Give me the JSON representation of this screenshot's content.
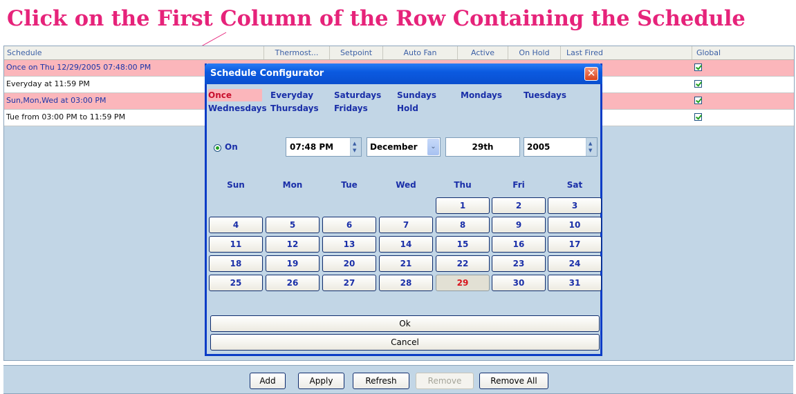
{
  "banner": {
    "text": "Click on the First Column of the Row Containing the Schedule"
  },
  "table": {
    "columns": [
      {
        "label": "Schedule"
      },
      {
        "label": "Thermost..."
      },
      {
        "label": "Setpoint"
      },
      {
        "label": "Auto Fan"
      },
      {
        "label": "Active"
      },
      {
        "label": "On Hold"
      },
      {
        "label": "Last Fired"
      },
      {
        "label": "Global"
      }
    ],
    "rows": [
      {
        "schedule": "Once on Thu 12/29/2005 07:48:00 PM",
        "global": true
      },
      {
        "schedule": "Everyday at 11:59 PM",
        "global": true
      },
      {
        "schedule": "Sun,Mon,Wed at 03:00 PM",
        "global": true
      },
      {
        "schedule": "Tue from 03:00 PM to 11:59 PM",
        "global": true
      }
    ]
  },
  "bottom_buttons": {
    "add": "Add",
    "apply": "Apply",
    "refresh": "Refresh",
    "remove": "Remove",
    "remove_all": "Remove All"
  },
  "dialog": {
    "title": "Schedule Configurator",
    "close_icon": "close-icon",
    "frequencies": [
      {
        "label": "Once",
        "selected": true
      },
      {
        "label": "Everyday"
      },
      {
        "label": "Saturdays"
      },
      {
        "label": "Sundays"
      },
      {
        "label": "Mondays"
      },
      {
        "label": "Tuesdays"
      },
      {
        "label": "Wednesdays"
      },
      {
        "label": "Thursdays"
      },
      {
        "label": "Fridays"
      },
      {
        "label": "Hold"
      }
    ],
    "on_label": "On",
    "time": "07:48 PM",
    "month": "December",
    "day_text": "29th",
    "year": "2005",
    "weekdays": [
      "Sun",
      "Mon",
      "Tue",
      "Wed",
      "Thu",
      "Fri",
      "Sat"
    ],
    "dates": [
      "1",
      "2",
      "3",
      "4",
      "5",
      "6",
      "7",
      "8",
      "9",
      "10",
      "11",
      "12",
      "13",
      "14",
      "15",
      "16",
      "17",
      "18",
      "19",
      "20",
      "21",
      "22",
      "23",
      "24",
      "25",
      "26",
      "27",
      "28",
      "29",
      "30",
      "31"
    ],
    "first_weekday_index": 4,
    "today": "29",
    "ok_label": "Ok",
    "cancel_label": "Cancel"
  },
  "colors": {
    "banner": "#e6237a",
    "selected_row": "#fbb6bb",
    "panel": "#c2d6e6",
    "titlebar": "#0b5ae0",
    "calendar_text": "#1a2fa8",
    "today_text": "#d8141c"
  }
}
